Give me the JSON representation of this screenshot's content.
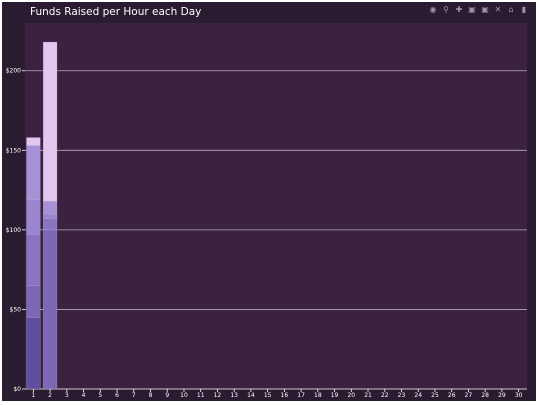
{
  "title": "Funds Raised per Hour each Day",
  "colors": {
    "outer_bg": "#2b1b31",
    "plot_bg": "#3a2240",
    "grid": "#b7a8bb",
    "axis": "#ffffff",
    "text": "#ffffff"
  },
  "modebar": {
    "icons": [
      "camera-icon",
      "zoom-icon",
      "pan-icon",
      "zoom-in-icon",
      "zoom-out-icon",
      "autoscale-icon",
      "reset-axes-icon",
      "plotly-logo-icon"
    ]
  },
  "chart_data": {
    "type": "bar",
    "stacked": true,
    "categories": [
      "1",
      "2",
      "3",
      "4",
      "5",
      "6",
      "7",
      "8",
      "9",
      "10",
      "11",
      "12",
      "13",
      "14",
      "15",
      "16",
      "17",
      "18",
      "19",
      "20",
      "21",
      "22",
      "23",
      "24",
      "25",
      "26",
      "27",
      "28",
      "29",
      "30"
    ],
    "ylim": [
      0,
      230
    ],
    "yticks": [
      0,
      50,
      100,
      150,
      200
    ],
    "ytick_labels": [
      "$0",
      "$50",
      "$100",
      "$150",
      "$200"
    ],
    "grid": true,
    "title": "Funds Raised per Hour each Day",
    "xlabel": "",
    "ylabel": "",
    "series": [
      {
        "color": "#5f4f9e",
        "values": [
          45,
          0,
          0,
          0,
          0,
          0,
          0,
          0,
          0,
          0,
          0,
          0,
          0,
          0,
          0,
          0,
          0,
          0,
          0,
          0,
          0,
          0,
          0,
          0,
          0,
          0,
          0,
          0,
          0,
          0
        ]
      },
      {
        "color": "#7c68b5",
        "values": [
          20,
          100,
          0,
          0,
          0,
          0,
          0,
          0,
          0,
          0,
          0,
          0,
          0,
          0,
          0,
          0,
          0,
          0,
          0,
          0,
          0,
          0,
          0,
          0,
          0,
          0,
          0,
          0,
          0,
          0
        ]
      },
      {
        "color": "#8a74c2",
        "values": [
          32,
          7,
          0,
          0,
          0,
          0,
          0,
          0,
          0,
          0,
          0,
          0,
          0,
          0,
          0,
          0,
          0,
          0,
          0,
          0,
          0,
          0,
          0,
          0,
          0,
          0,
          0,
          0,
          0,
          0
        ]
      },
      {
        "color": "#9a85cf",
        "values": [
          22,
          3,
          0,
          0,
          0,
          0,
          0,
          0,
          0,
          0,
          0,
          0,
          0,
          0,
          0,
          0,
          0,
          0,
          0,
          0,
          0,
          0,
          0,
          0,
          0,
          0,
          0,
          0,
          0,
          0
        ]
      },
      {
        "color": "#a791d6",
        "values": [
          34,
          8,
          0,
          0,
          0,
          0,
          0,
          0,
          0,
          0,
          0,
          0,
          0,
          0,
          0,
          0,
          0,
          0,
          0,
          0,
          0,
          0,
          0,
          0,
          0,
          0,
          0,
          0,
          0,
          0
        ]
      },
      {
        "color": "#e2c8ee",
        "values": [
          5,
          100,
          0,
          0,
          0,
          0,
          0,
          0,
          0,
          0,
          0,
          0,
          0,
          0,
          0,
          0,
          0,
          0,
          0,
          0,
          0,
          0,
          0,
          0,
          0,
          0,
          0,
          0,
          0,
          0
        ]
      }
    ]
  }
}
